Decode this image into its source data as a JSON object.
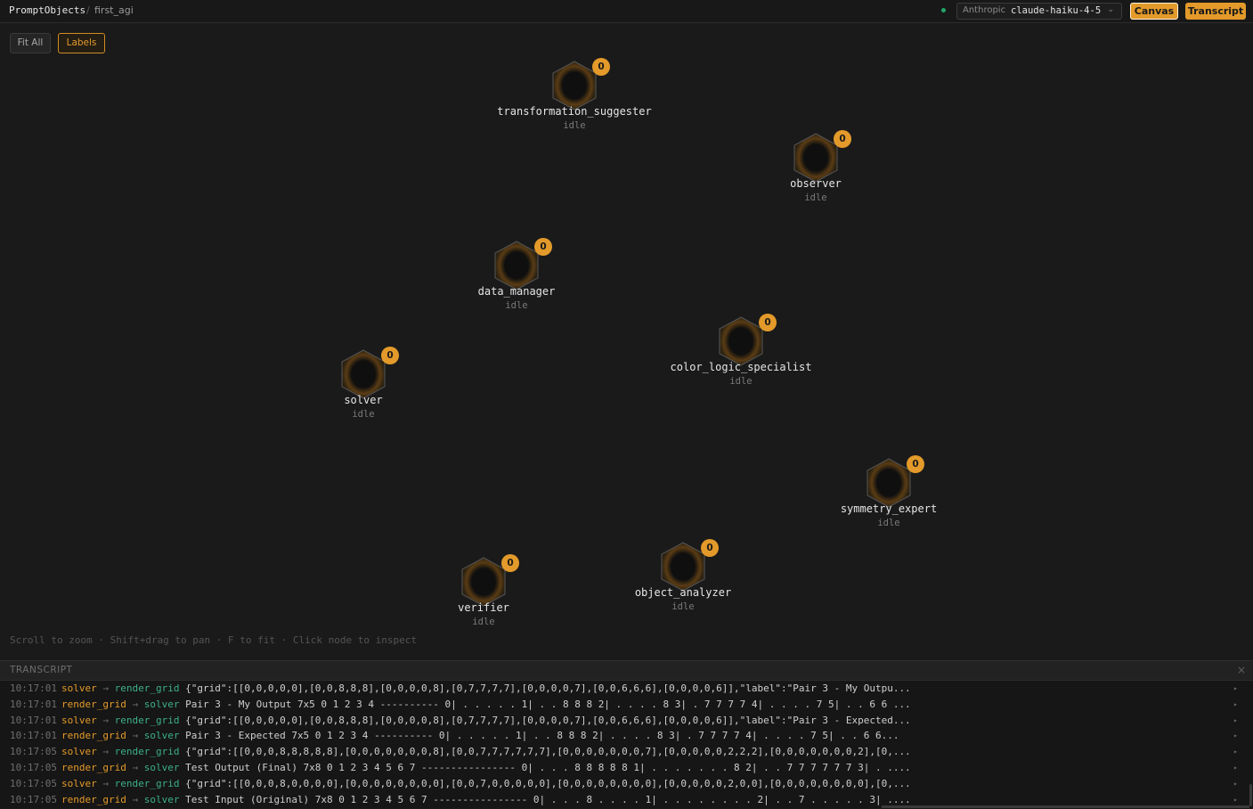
{
  "header": {
    "brand": "PromptObjects",
    "separator": "/",
    "project": "first_agi",
    "provider": "Anthropic",
    "model": "claude-haiku-4-5",
    "canvas_label": "Canvas",
    "transcript_label": "Transcript"
  },
  "toolbar": {
    "fit_all_label": "Fit All",
    "labels_label": "Labels"
  },
  "hint": "Scroll to zoom · Shift+drag to pan · F to fit · Click node to inspect",
  "nodes": [
    {
      "name": "transformation_suggester",
      "status": "idle",
      "count": "0"
    },
    {
      "name": "observer",
      "status": "idle",
      "count": "0"
    },
    {
      "name": "data_manager",
      "status": "idle",
      "count": "0"
    },
    {
      "name": "color_logic_specialist",
      "status": "idle",
      "count": "0"
    },
    {
      "name": "solver",
      "status": "idle",
      "count": "0"
    },
    {
      "name": "symmetry_expert",
      "status": "idle",
      "count": "0"
    },
    {
      "name": "object_analyzer",
      "status": "idle",
      "count": "0"
    },
    {
      "name": "verifier",
      "status": "idle",
      "count": "0"
    }
  ],
  "transcript": {
    "title": "TRANSCRIPT",
    "rows": [
      {
        "time": "10:17:01",
        "from": "solver",
        "arrow": "→",
        "to": "render_grid",
        "msg": "{\"grid\":[[0,0,0,0,0],[0,0,8,8,8],[0,0,0,0,8],[0,7,7,7,7],[0,0,0,0,7],[0,0,6,6,6],[0,0,0,0,6]],\"label\":\"Pair 3 - My Outpu..."
      },
      {
        "time": "10:17:01",
        "from": "render_grid",
        "arrow": "→",
        "to": "solver",
        "msg": "Pair 3 - My Output 7x5 0 1 2 3 4 ---------- 0| . . . . . 1| . . 8 8 8 2| . . . . 8 3| . 7 7 7 7 4| . . . . 7 5| . . 6 6 ..."
      },
      {
        "time": "10:17:01",
        "from": "solver",
        "arrow": "→",
        "to": "render_grid",
        "msg": "{\"grid\":[[0,0,0,0,0],[0,0,8,8,8],[0,0,0,0,8],[0,7,7,7,7],[0,0,0,0,7],[0,0,6,6,6],[0,0,0,0,6]],\"label\":\"Pair 3 - Expected..."
      },
      {
        "time": "10:17:01",
        "from": "render_grid",
        "arrow": "→",
        "to": "solver",
        "msg": "Pair 3 - Expected 7x5 0 1 2 3 4 ---------- 0| . . . . . 1| . . 8 8 8 2| . . . . 8 3| . 7 7 7 7 4| . . . . 7 5| . . 6 6..."
      },
      {
        "time": "10:17:05",
        "from": "solver",
        "arrow": "→",
        "to": "render_grid",
        "msg": "{\"grid\":[[0,0,0,8,8,8,8,8],[0,0,0,0,0,0,0,8],[0,0,7,7,7,7,7,7],[0,0,0,0,0,0,0,7],[0,0,0,0,0,2,2,2],[0,0,0,0,0,0,0,2],[0,..."
      },
      {
        "time": "10:17:05",
        "from": "render_grid",
        "arrow": "→",
        "to": "solver",
        "msg": "Test Output (Final) 7x8 0 1 2 3 4 5 6 7 ---------------- 0| . . . 8 8 8 8 8 1| . . . . . . . 8 2| . . 7 7 7 7 7 7 3| . ...."
      },
      {
        "time": "10:17:05",
        "from": "solver",
        "arrow": "→",
        "to": "render_grid",
        "msg": "{\"grid\":[[0,0,0,8,0,0,0,0],[0,0,0,0,0,0,0,0],[0,0,7,0,0,0,0,0],[0,0,0,0,0,0,0,0],[0,0,0,0,0,2,0,0],[0,0,0,0,0,0,0,0],[0,..."
      },
      {
        "time": "10:17:05",
        "from": "render_grid",
        "arrow": "→",
        "to": "solver",
        "msg": "Test Input (Original) 7x8 0 1 2 3 4 5 6 7 ---------------- 0| . . . 8 . . . . 1| . . . . . . . . 2| . . 7 . . . . . 3| ...."
      }
    ]
  }
}
